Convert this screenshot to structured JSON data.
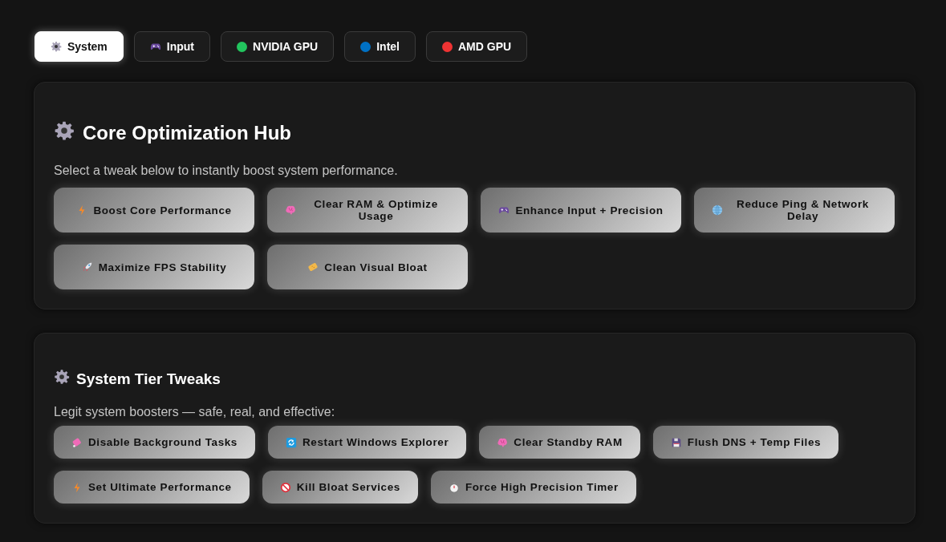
{
  "tabs": [
    {
      "label": "System",
      "kind": "gear",
      "selected": true
    },
    {
      "label": "Input",
      "kind": "gamepad",
      "selected": false
    },
    {
      "label": "NVIDIA GPU",
      "kind": "dot",
      "color": "#22c55e",
      "selected": false
    },
    {
      "label": "Intel",
      "kind": "dot",
      "color": "#0071c5",
      "selected": false
    },
    {
      "label": "AMD GPU",
      "kind": "dot",
      "color": "#ef3333",
      "selected": false
    }
  ],
  "sections": [
    {
      "title": "Core Optimization Hub",
      "kind": "hub",
      "subtitle": "Select a tweak below to instantly boost system performance.",
      "buttons": [
        {
          "label": "Boost Core Performance",
          "kind": "bolt"
        },
        {
          "label": "Clear RAM & Optimize Usage",
          "kind": "brain"
        },
        {
          "label": "Enhance Input + Precision",
          "kind": "gamepad"
        },
        {
          "label": "Reduce Ping & Network Delay",
          "kind": "globe"
        },
        {
          "label": "Maximize FPS Stability",
          "kind": "rocket"
        },
        {
          "label": "Clean Visual Bloat",
          "kind": "sponge"
        }
      ]
    },
    {
      "title": "System Tier Tweaks",
      "kind": "tier",
      "subtitle": "Legit system boosters — safe, real, and effective:",
      "buttons": [
        {
          "label": "Disable Background Tasks",
          "kind": "eraser"
        },
        {
          "label": "Restart Windows Explorer",
          "kind": "refresh"
        },
        {
          "label": "Clear Standby RAM",
          "kind": "brain"
        },
        {
          "label": "Flush DNS + Temp Files",
          "kind": "floppy"
        },
        {
          "label": "Set Ultimate Performance",
          "kind": "bolt"
        },
        {
          "label": "Kill Bloat Services",
          "kind": "block"
        },
        {
          "label": "Force High Precision Timer",
          "kind": "stopwatch"
        }
      ]
    }
  ]
}
